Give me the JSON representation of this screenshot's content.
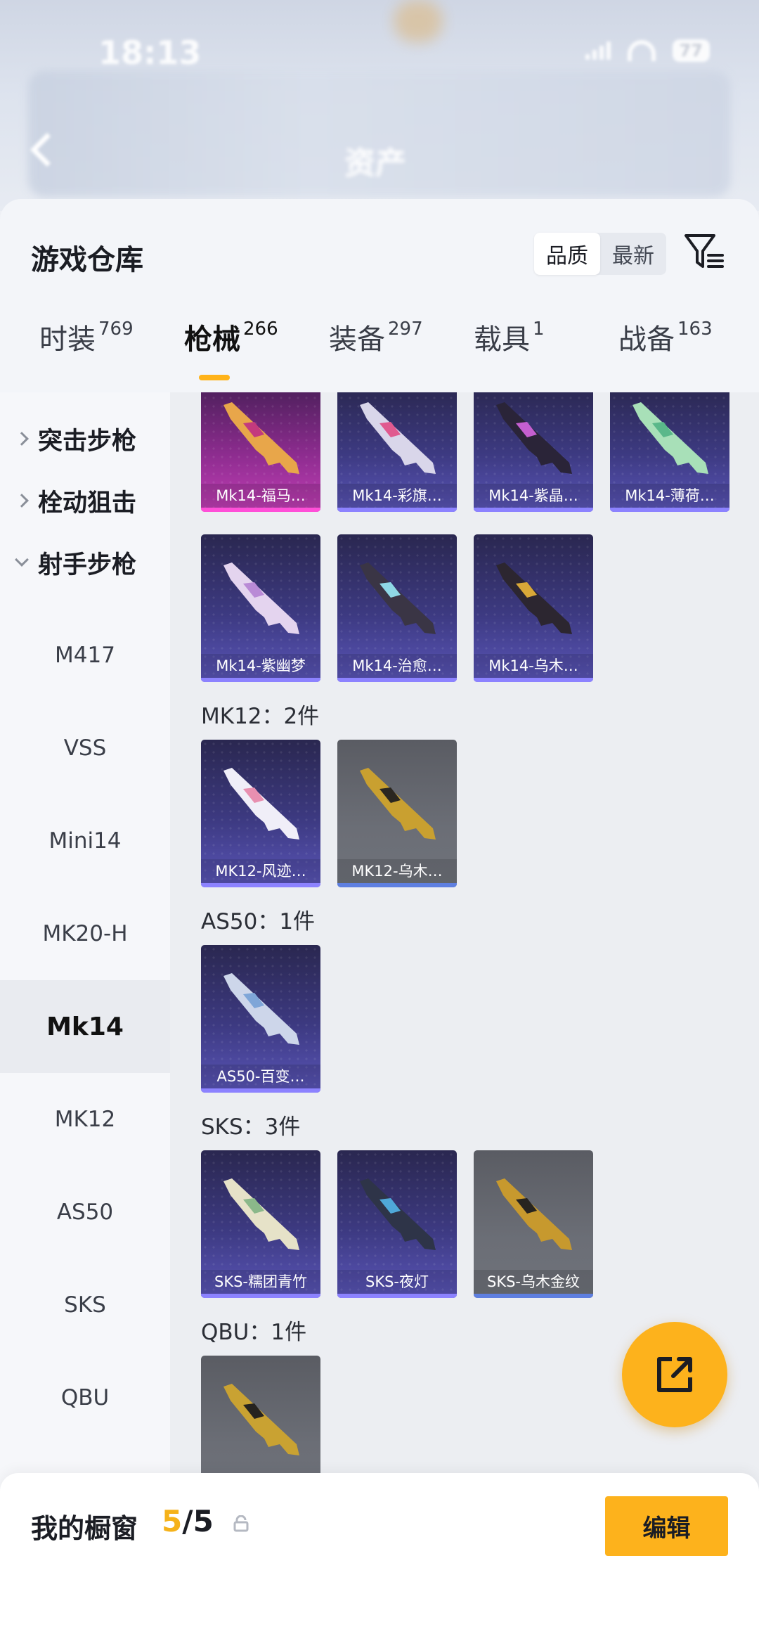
{
  "status_bar": {
    "time": "18:13",
    "battery": "77"
  },
  "background_header": {
    "title": "资产"
  },
  "warehouse": {
    "title": "游戏仓库",
    "sort_options": [
      "品质",
      "最新"
    ],
    "sort_selected": "品质",
    "tabs": [
      {
        "label": "时装",
        "count": "769"
      },
      {
        "label": "枪械",
        "count": "266",
        "active": true
      },
      {
        "label": "装备",
        "count": "297"
      },
      {
        "label": "载具",
        "count": "1"
      },
      {
        "label": "战备",
        "count": "163"
      }
    ]
  },
  "sidebar": {
    "groups": [
      {
        "label": "突击步枪",
        "expanded": false
      },
      {
        "label": "栓动狙击",
        "expanded": false
      },
      {
        "label": "射手步枪",
        "expanded": true
      }
    ],
    "items": [
      "M417",
      "VSS",
      "Mini14",
      "MK20-H",
      "Mk14",
      "MK12",
      "AS50",
      "SKS",
      "QBU"
    ],
    "selected": "Mk14"
  },
  "sections": [
    {
      "label": "",
      "items": [
        {
          "name": "Mk14-福马…",
          "quality": "pink"
        },
        {
          "name": "Mk14-彩旗…",
          "quality": "purple"
        },
        {
          "name": "Mk14-紫晶…",
          "quality": "purple"
        },
        {
          "name": "Mk14-薄荷…",
          "quality": "purple"
        },
        {
          "name": "Mk14-紫幽梦",
          "quality": "purple"
        },
        {
          "name": "Mk14-治愈…",
          "quality": "purple"
        },
        {
          "name": "Mk14-乌木…",
          "quality": "purple"
        }
      ]
    },
    {
      "label": "MK12：2件",
      "items": [
        {
          "name": "MK12-风迹…",
          "quality": "purple"
        },
        {
          "name": "MK12-乌木…",
          "quality": "gray"
        }
      ]
    },
    {
      "label": "AS50：1件",
      "items": [
        {
          "name": "AS50-百变…",
          "quality": "purple"
        }
      ]
    },
    {
      "label": "SKS：3件",
      "items": [
        {
          "name": "SKS-糯团青竹",
          "quality": "purple"
        },
        {
          "name": "SKS-夜灯",
          "quality": "purple"
        },
        {
          "name": "SKS-乌木金纹",
          "quality": "gray"
        }
      ]
    },
    {
      "label": "QBU：1件",
      "items": [
        {
          "name": "",
          "quality": "gray"
        }
      ]
    }
  ],
  "fab_icon": "share-external-icon",
  "showcase": {
    "title": "我的橱窗",
    "current": "5",
    "total": "/5",
    "edit_label": "编辑"
  },
  "colors": {
    "accent": "#fdb21c",
    "purple_edge": "#8c82ff",
    "pink_edge": "#ff4fd8",
    "gray_edge": "#5e7fe0"
  }
}
